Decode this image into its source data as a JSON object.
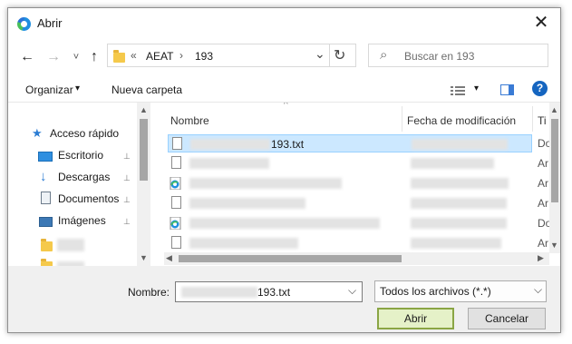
{
  "window": {
    "title": "Abrir",
    "close": "✕"
  },
  "nav": {
    "back": "←",
    "forward": "→",
    "recent": "˅",
    "up": "↑",
    "refresh": "↻"
  },
  "address": {
    "chevrons": "«",
    "crumbs": [
      "AEAT",
      "193"
    ],
    "sep": "›",
    "dropdown": "⌄"
  },
  "search": {
    "placeholder": "Buscar en 193",
    "icon": "⌕"
  },
  "toolbar": {
    "organize": "Organizar",
    "new_folder": "Nueva carpeta",
    "caret": "▾",
    "help": "?"
  },
  "sidebar": {
    "items": [
      {
        "label": "Acceso rápido",
        "pinned": false
      },
      {
        "label": "Escritorio",
        "pinned": true
      },
      {
        "label": "Descargas",
        "pinned": true
      },
      {
        "label": "Documentos",
        "pinned": true
      },
      {
        "label": "Imágenes",
        "pinned": true
      }
    ],
    "pin": "📌"
  },
  "columns": {
    "name": "Nombre",
    "date": "Fecha de modificación",
    "type": "Ti"
  },
  "files": [
    {
      "name_suffix": "193.txt",
      "type": "Do",
      "icon": "text-file",
      "selected": true
    },
    {
      "name_suffix": "",
      "type": "Ar",
      "icon": "text-file",
      "selected": false
    },
    {
      "name_suffix": "",
      "type": "Ar",
      "icon": "edge-file",
      "selected": false
    },
    {
      "name_suffix": "",
      "type": "Ar",
      "icon": "text-file",
      "selected": false
    },
    {
      "name_suffix": "",
      "type": "Do",
      "icon": "edge-file",
      "selected": false
    },
    {
      "name_suffix": "",
      "type": "Ar",
      "icon": "text-file",
      "selected": false
    }
  ],
  "footer": {
    "name_label": "Nombre:",
    "name_value": "193.txt",
    "filter_value": "Todos los archivos (*.*)",
    "open": "Abrir",
    "cancel": "Cancelar"
  }
}
